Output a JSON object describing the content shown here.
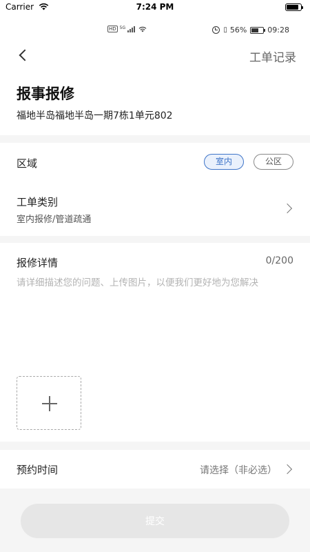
{
  "ios_status": {
    "carrier": "Carrier",
    "time": "7:24 PM"
  },
  "android_status": {
    "hd": "HD",
    "network": "5G",
    "battery_percent": "56%",
    "time": "09:28"
  },
  "nav": {
    "action": "工单记录"
  },
  "header": {
    "title": "报事报修",
    "address": "福地半岛福地半岛一期7栋1单元802"
  },
  "region": {
    "label": "区域",
    "options": [
      "室内",
      "公区"
    ],
    "selected": "室内"
  },
  "category": {
    "label": "工单类别",
    "value": "室内报修/管道疏通"
  },
  "detail": {
    "label": "报修详情",
    "counter": "0/200",
    "placeholder": "请详细描述您的问题、上传图片，以便我们更好地为您解决"
  },
  "appointment": {
    "label": "预约时间",
    "value": "请选择（非必选）"
  },
  "submit": {
    "label": "提交"
  },
  "colors": {
    "accent": "#3e74c8",
    "background": "#f5f5f5",
    "submit_disabled": "#e6e6e6"
  }
}
